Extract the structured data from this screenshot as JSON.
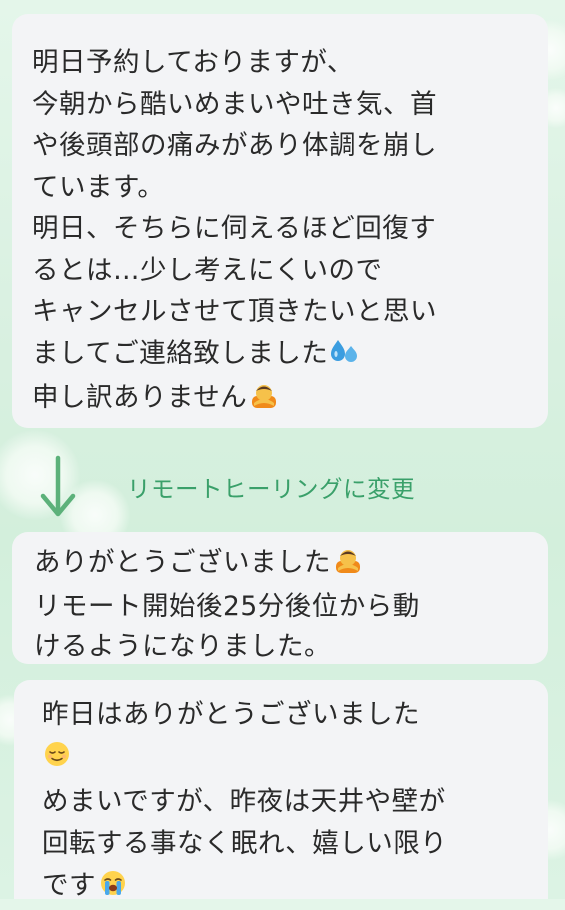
{
  "messages": [
    {
      "lines": [
        "明日予約しておりますが、",
        "今朝から酷いめまいや吐き気、首",
        "や後頭部の痛みがあり体調を崩し",
        "ています。",
        "明日、そちらに伺えるほど回復す",
        "るとは…少し考えにくいので",
        "キャンセルさせて頂きたいと思い",
        "ましてご連絡致しました",
        "申し訳ありません"
      ],
      "emojis": [
        "sweat-droplets-emoji",
        "bowing-person-emoji"
      ]
    },
    {
      "lines": [
        "ありがとうございました",
        "リモート開始後25分後位から動",
        "けるようになりました。"
      ],
      "emojis": [
        "bowing-person-emoji"
      ]
    },
    {
      "lines": [
        "昨日はありがとうございました",
        "めまいですが、昨夜は天井や壁が",
        "回転する事なく眠れ、嬉しい限り",
        "です"
      ],
      "emojis": [
        "relieved-face-emoji",
        "loudly-crying-face-emoji"
      ]
    }
  ],
  "annotation": {
    "text": "リモートヒーリングに変更",
    "icon": "down-arrow-icon",
    "color": "#3aa06a"
  },
  "colors": {
    "bubble": "#f3f4f6",
    "text": "#2a2a2a",
    "background": "#d8f0e0"
  }
}
